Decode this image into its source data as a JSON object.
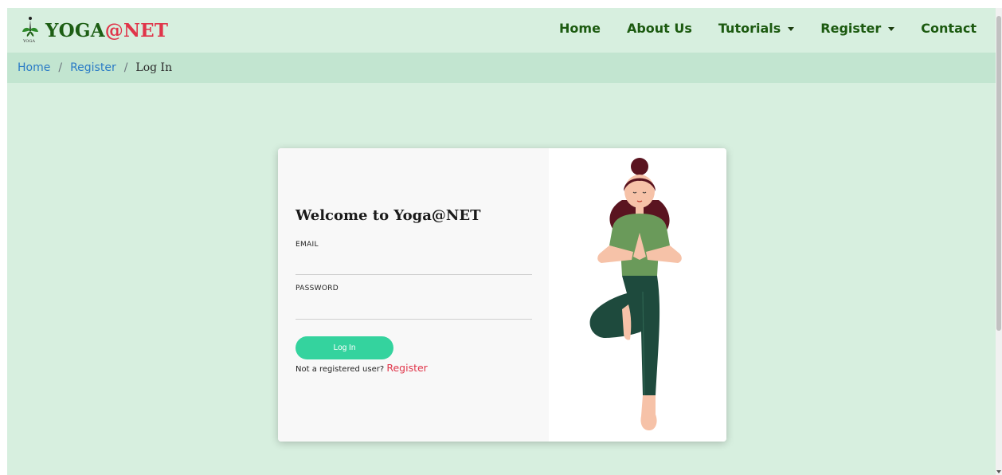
{
  "brand": {
    "name_part1": "YOGA",
    "name_part2": "@NET",
    "logo_icon": "yoga-figure-logo-icon",
    "logo_caption": "YOGA"
  },
  "nav": {
    "items": [
      {
        "label": "Home",
        "dropdown": false
      },
      {
        "label": "About Us",
        "dropdown": false
      },
      {
        "label": "Tutorials",
        "dropdown": true
      },
      {
        "label": "Register",
        "dropdown": true
      },
      {
        "label": "Contact",
        "dropdown": false
      }
    ]
  },
  "breadcrumb": {
    "items": [
      "Home",
      "Register"
    ],
    "separator": "/",
    "current": "Log In"
  },
  "login": {
    "title": "Welcome to Yoga@NET",
    "email_label": "EMAIL",
    "email_value": "",
    "password_label": "PASSWORD",
    "password_value": "",
    "button_label": "Log In",
    "not_registered_text": "Not a registered user?",
    "register_link": "Register"
  },
  "colors": {
    "page_bg": "#d7efdf",
    "breadcrumb_bg": "#c2e5d0",
    "brand_green": "#1d5e14",
    "brand_red": "#e0354a",
    "button_green": "#34d39e",
    "link_blue": "#2a7bc6"
  }
}
